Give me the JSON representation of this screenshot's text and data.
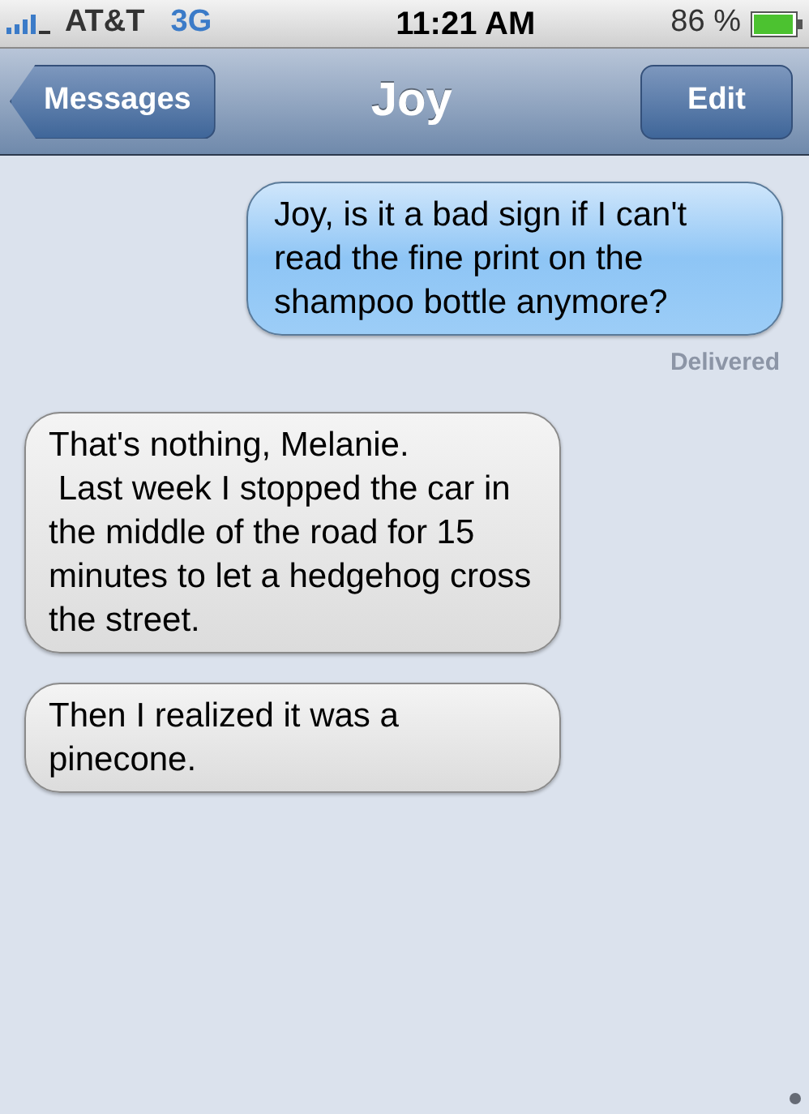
{
  "status_bar": {
    "carrier": "AT&T",
    "network": "3G",
    "time": "11:21 AM",
    "battery": "86 %"
  },
  "nav_bar": {
    "back_button": "Messages",
    "title": "Joy",
    "edit_button": "Edit"
  },
  "messages": [
    {
      "kind": "sent",
      "text": "Joy, is it a bad sign if I can't read the fine print on the shampoo bottle anymore?"
    },
    {
      "kind": "status",
      "text": "Delivered"
    },
    {
      "kind": "received",
      "text": "That's nothing, Melanie.\n Last week I stopped the car in the middle of the road for 15 minutes to let a hedgehog cross the street."
    },
    {
      "kind": "received",
      "text": "Then I realized it was a pinecone."
    }
  ]
}
